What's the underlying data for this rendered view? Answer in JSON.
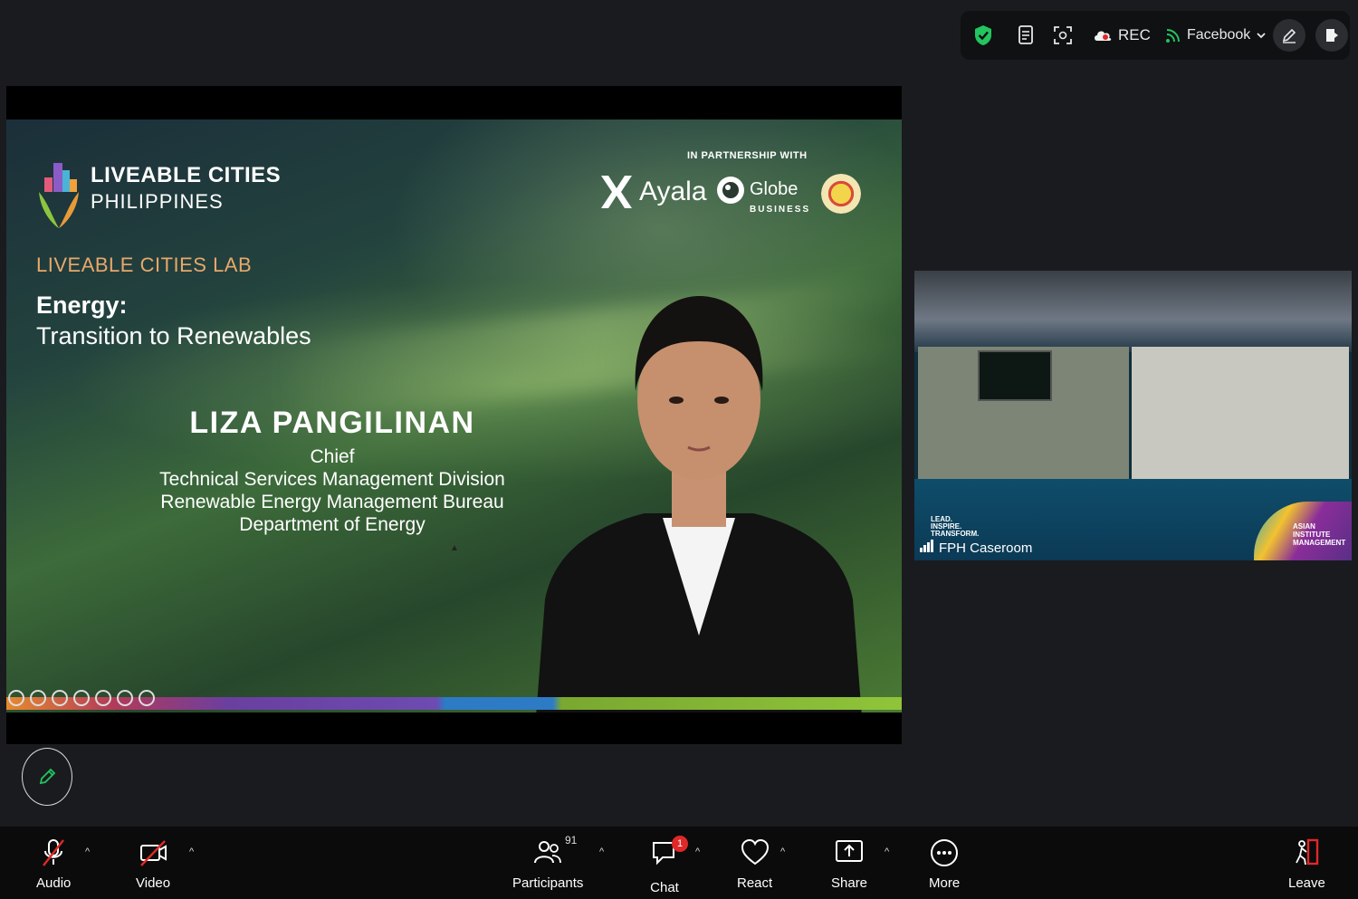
{
  "topbar": {
    "rec_label": "REC",
    "stream_label": "Facebook",
    "icons": [
      "shield-check-icon",
      "notes-icon",
      "focus-icon",
      "cloud-record-icon",
      "live-stream-icon",
      "annotate-icon",
      "leave-exit-icon"
    ],
    "security_color": "#22c55e"
  },
  "slide": {
    "brand_line1": "LIVEABLE CITIES",
    "brand_line2": "PHILIPPINES",
    "lab_title": "LIVEABLE CITIES LAB",
    "topic": "Energy:",
    "subtopic": "Transition to Renewables",
    "partnership": "IN PARTNERSHIP WITH",
    "partner1": "Ayala",
    "partner2": "Globe",
    "partner2_sub": "BUSINESS",
    "speaker_name": "LIZA PANGILINAN",
    "role_lines": [
      "Chief",
      "Technical Services Management Division",
      "Renewable Energy Management Bureau",
      "Department of Energy"
    ],
    "lab_color": "#e8a86a"
  },
  "side_video": {
    "label": "FPH Caseroom",
    "overlay_left": [
      "LEAD.",
      "INSPIRE.",
      "TRANSFORM."
    ],
    "overlay_right": [
      "ASIAN",
      "INSTITUTE",
      "MANAGEMENT"
    ]
  },
  "toolbar": {
    "audio": "Audio",
    "video": "Video",
    "participants": "Participants",
    "participants_count": "91",
    "chat": "Chat",
    "chat_badge": "1",
    "react": "React",
    "share": "Share",
    "more": "More",
    "leave": "Leave",
    "leave_color": "#e02828"
  }
}
